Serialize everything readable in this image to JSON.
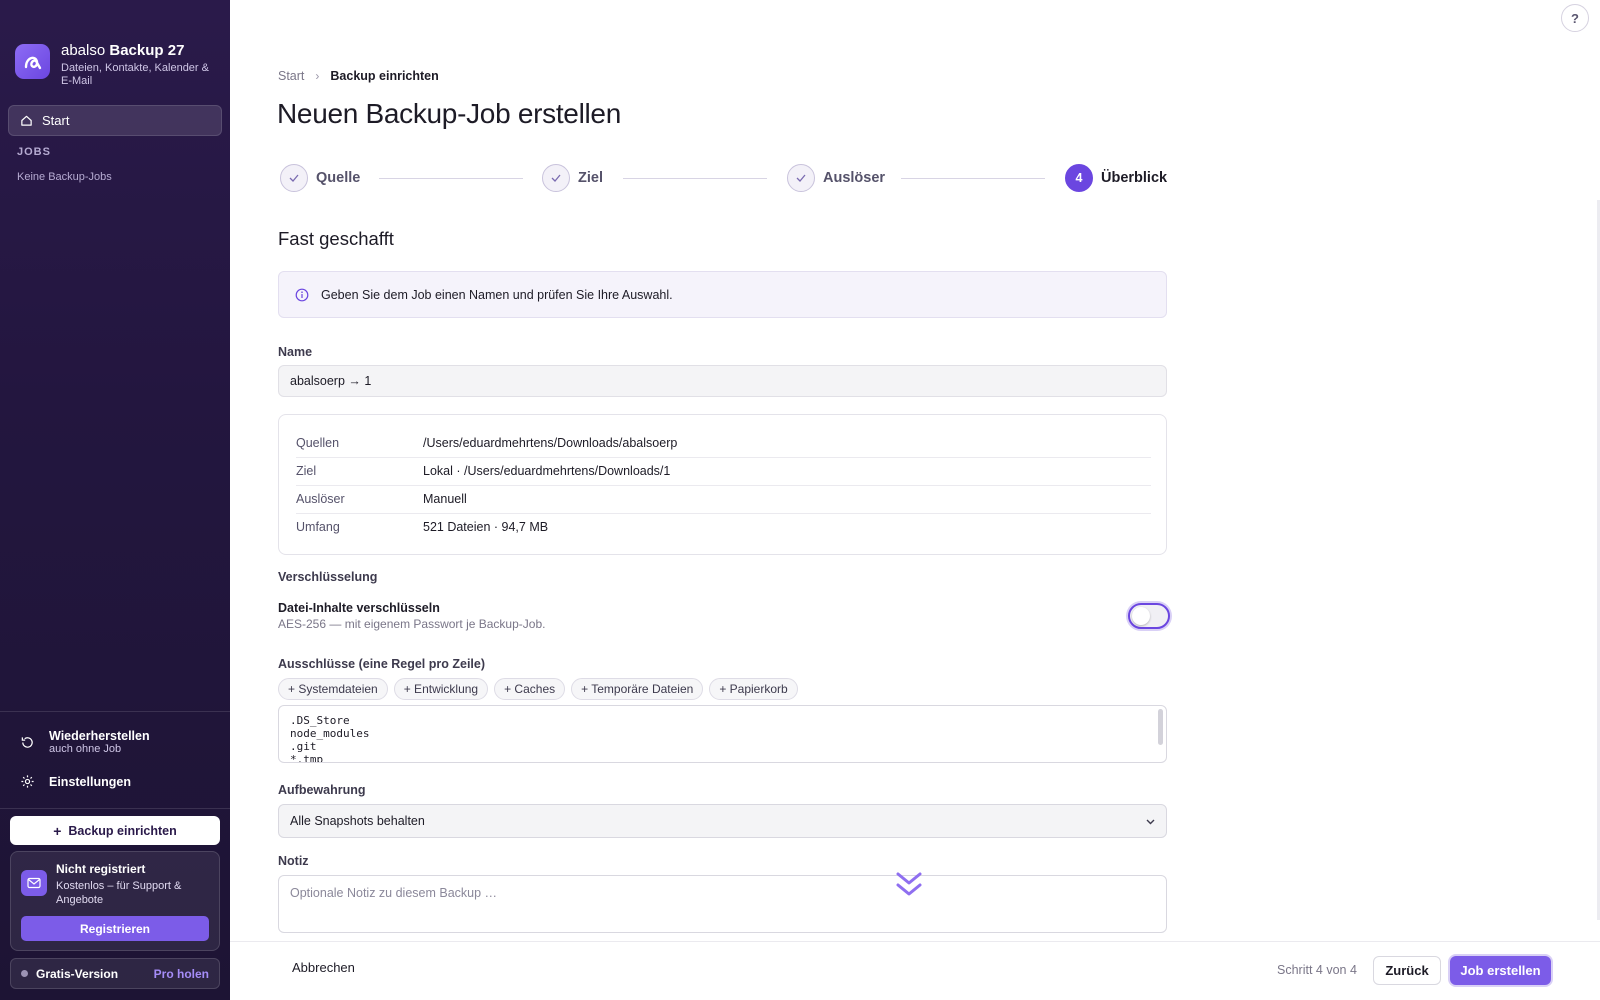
{
  "app": {
    "name_light": "abalso",
    "name_bold": "Backup 27",
    "subtitle": "Dateien, Kontakte, Kalender & E-Mail"
  },
  "sidebar": {
    "start_label": "Start",
    "jobs_heading": "JOBS",
    "jobs_empty": "Keine Backup-Jobs",
    "restore_label": "Wiederherstellen",
    "restore_sub": "auch ohne Job",
    "settings_label": "Einstellungen",
    "setup_button": "Backup einrichten",
    "register": {
      "title": "Nicht registriert",
      "subtitle": "Kostenlos – für Support & Angebote",
      "button": "Registrieren"
    },
    "plan": {
      "label": "Gratis-Version",
      "upgrade": "Pro holen"
    }
  },
  "header": {
    "help": "?",
    "breadcrumb": [
      "Start",
      "Backup einrichten"
    ],
    "title": "Neuen Backup-Job erstellen"
  },
  "stepper": {
    "steps": [
      {
        "label": "Quelle",
        "state": "done"
      },
      {
        "label": "Ziel",
        "state": "done"
      },
      {
        "label": "Auslöser",
        "state": "done"
      },
      {
        "label": "Überblick",
        "state": "active",
        "number": "4"
      }
    ]
  },
  "overview": {
    "title": "Fast geschafft",
    "info": "Geben Sie dem Job einen Namen und prüfen Sie Ihre Auswahl.",
    "name_label": "Name",
    "name_value": "abalsoerp → 1",
    "summary": [
      {
        "key": "Quellen",
        "value": "/Users/eduardmehrtens/Downloads/abalsoerp"
      },
      {
        "key": "Ziel",
        "value": "Lokal · /Users/eduardmehrtens/Downloads/1"
      },
      {
        "key": "Auslöser",
        "value": "Manuell"
      },
      {
        "key": "Umfang",
        "value": "521 Dateien · 94,7 MB"
      }
    ],
    "encryption": {
      "heading": "Verschlüsselung",
      "title": "Datei-Inhalte verschlüsseln",
      "subtitle": "AES-256 — mit eigenem Passwort je Backup-Job.",
      "enabled": false
    },
    "exclusions": {
      "label": "Ausschlüsse (eine Regel pro Zeile)",
      "chips": [
        "+ Systemdateien",
        "+ Entwicklung",
        "+ Caches",
        "+ Temporäre Dateien",
        "+ Papierkorb"
      ],
      "lines": [
        ".DS_Store",
        "node_modules",
        ".git",
        "*.tmp"
      ]
    },
    "retention": {
      "label": "Aufbewahrung",
      "value": "Alle Snapshots behalten"
    },
    "note": {
      "label": "Notiz",
      "placeholder": "Optionale Notiz zu diesem Backup …"
    }
  },
  "footer": {
    "cancel": "Abbrechen",
    "step_text": "Schritt 4 von 4",
    "back": "Zurück",
    "create": "Job erstellen"
  },
  "colors": {
    "accent": "#6b46e0",
    "accent_button": "#7c5ce8",
    "sidebar_bg": "#23163f"
  }
}
